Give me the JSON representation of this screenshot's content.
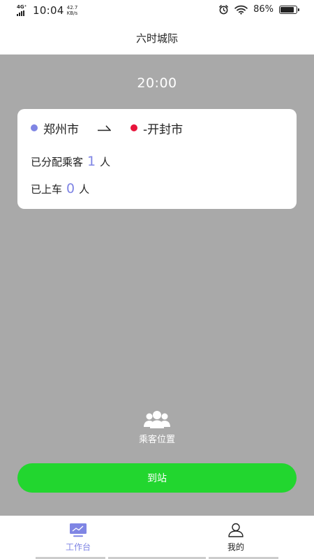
{
  "status_bar": {
    "network": "4G⁺",
    "time": "10:04",
    "speed_value": "42.7",
    "speed_unit": "KB/s",
    "battery_percent": "86%",
    "battery_level": 0.86
  },
  "header": {
    "title": "六时城际"
  },
  "trip": {
    "depart_time": "20:00",
    "from_city": "郑州市",
    "to_city": "-开封市",
    "assigned_label": "已分配乘客",
    "assigned_count": "1",
    "boarded_label": "已上车",
    "boarded_count": "0",
    "unit": "人"
  },
  "actions": {
    "passenger_location_label": "乘客位置",
    "arrive_button": "到站"
  },
  "tabbar": {
    "workbench": "工作台",
    "mine": "我的"
  },
  "colors": {
    "accent": "#7f85e4",
    "from_dot": "#7f85e4",
    "to_dot": "#e8143b",
    "button": "#22d62f",
    "background": "#a9a9a9"
  }
}
